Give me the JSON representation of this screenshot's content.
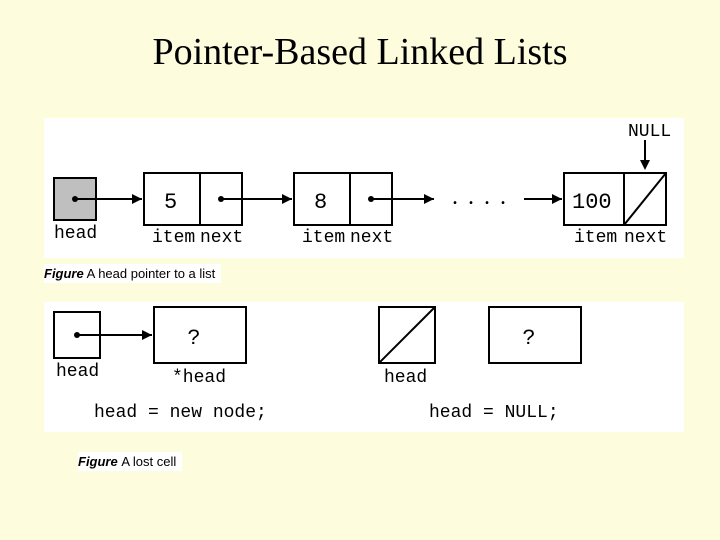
{
  "title": "Pointer-Based Linked Lists",
  "fig1": {
    "head_label": "head",
    "null_label": "NULL",
    "dots": ". . . .",
    "item_label": "item",
    "next_label": "next",
    "vals": [
      "5",
      "8",
      "100"
    ]
  },
  "caption1_a": "Figure",
  "caption1_b": "   A head pointer to a list",
  "fig2": {
    "head": "head",
    "star_head": "*head",
    "q": "?",
    "stmt1": "head = new node;",
    "stmt2": "head = NULL;"
  },
  "caption2_a": "Figure ",
  "caption2_b": "A lost cell"
}
